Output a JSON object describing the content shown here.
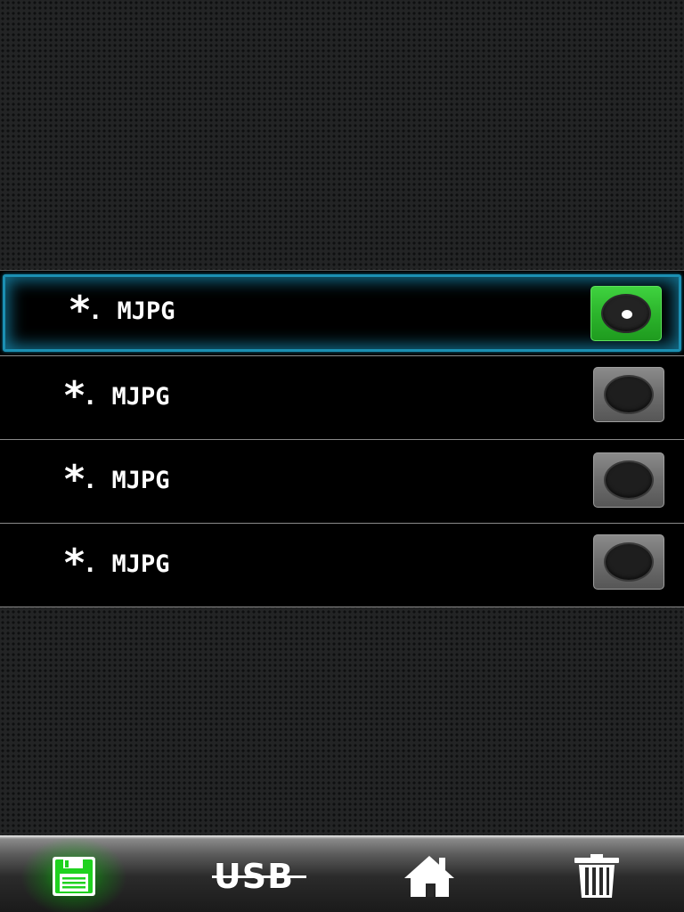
{
  "file_types": [
    {
      "star": "*",
      "ext": ". MJPG",
      "selected": true
    },
    {
      "star": "*",
      "ext": ". MJPG",
      "selected": false
    },
    {
      "star": "*",
      "ext": ". MJPG",
      "selected": false
    },
    {
      "star": "*",
      "ext": ". MJPG",
      "selected": false
    }
  ],
  "toolbar": {
    "save_icon": "save-icon",
    "usb_label": "USB",
    "home_icon": "home-icon",
    "trash_icon": "trash-icon"
  },
  "colors": {
    "selected_border": "#1b8fb2",
    "radio_on": "#2cb52c",
    "radio_off": "#6d6d6d",
    "active_glow": "#00e600"
  }
}
